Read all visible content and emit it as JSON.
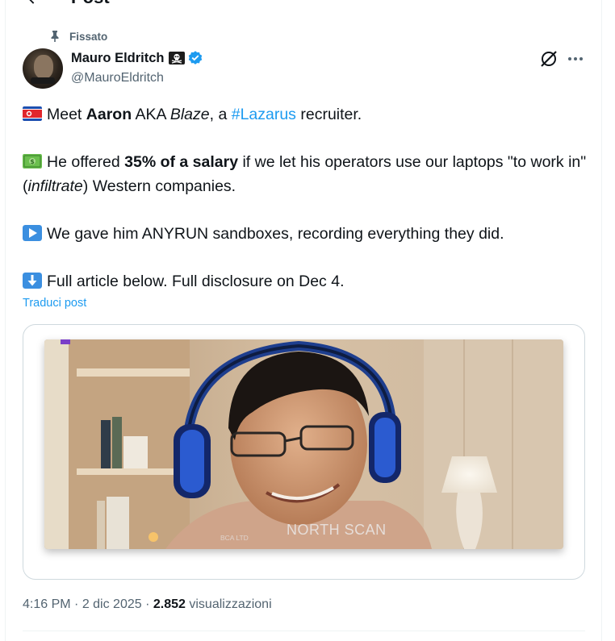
{
  "header": {
    "title": "Post"
  },
  "pinned": {
    "label": "Fissato"
  },
  "author": {
    "display_name": "Mauro Eldritch",
    "handle": "@MauroEldritch"
  },
  "tweet": {
    "line1": {
      "pre": "Meet ",
      "bold": "Aaron",
      "mid": " AKA ",
      "italic": "Blaze",
      "post": ", a ",
      "hashtag": "#Lazarus",
      "end": " recruiter."
    },
    "line2": {
      "pre": "He offered ",
      "bold": "35% of a salary",
      "post": " if we let his operators use our laptops \"to work in\" (",
      "italic": "infiltrate",
      "end": ") Western companies."
    },
    "line3": {
      "text": "We gave him ANYRUN sandboxes, recording everything they did."
    },
    "line4": {
      "text": "Full article below. Full disclosure on Dec 4."
    }
  },
  "translate_label": "Traduci post",
  "media": {
    "watermark": "NORTH SCAN",
    "watermark_sub": "BCA LTD"
  },
  "meta": {
    "time": "4:16 PM",
    "sep1": " · ",
    "date": "2 dic 2025",
    "sep2": " · ",
    "views_count": "2.852",
    "views_label": " visualizzazioni"
  },
  "icons": {
    "flag": "north-korea-flag-icon",
    "money": "dollar-banknote-icon",
    "play": "play-button-icon",
    "down": "down-arrow-icon",
    "skull": "pirate-flag-icon",
    "verified": "verified-badge-icon",
    "grok": "grok-icon",
    "more": "more-options-icon",
    "pin": "pin-icon"
  },
  "colors": {
    "accent": "#1d9bf0",
    "text": "#0f1419",
    "muted": "#536471"
  }
}
